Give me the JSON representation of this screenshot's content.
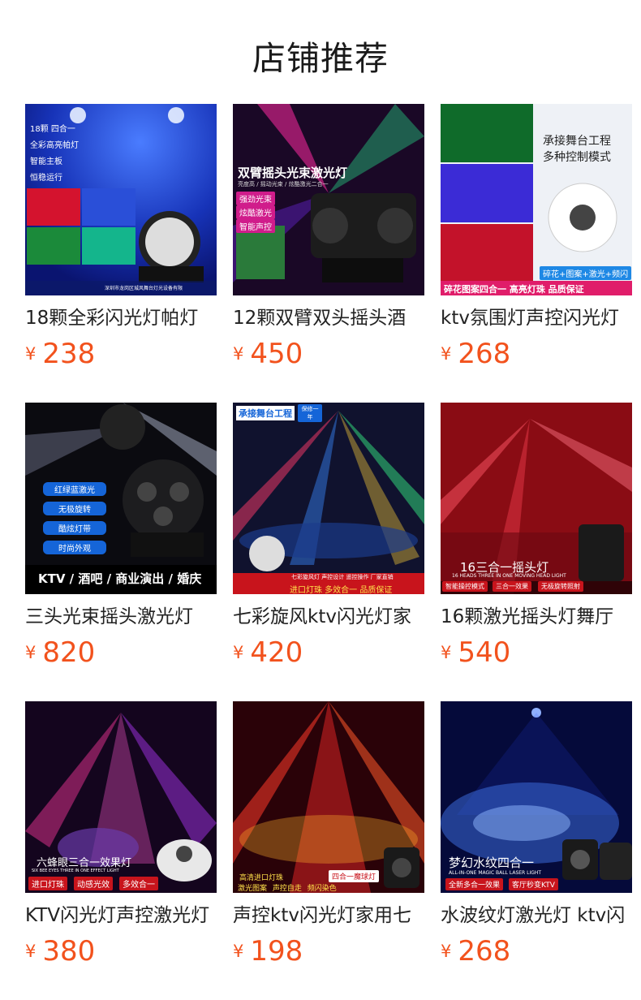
{
  "section_title": "店铺推荐",
  "currency": "¥",
  "colors": {
    "price": "#f2521d",
    "title": "#1a1a1a"
  },
  "products": [
    {
      "name": "18颗全彩闪光灯帕灯",
      "price": "238",
      "overlay": {
        "lines": [
          "18颗  四合一",
          "全彩高亮帕灯",
          "智能主板",
          "恒稳运行"
        ],
        "footer": "深圳市龙岗区城风舞台灯光设备有限"
      }
    },
    {
      "name": "12颗双臂双头摇头酒",
      "price": "450",
      "overlay": {
        "headline": "双臂摇头光束激光灯",
        "sub": "亮度高 / 摇动光束 / 炫酷激光二合一",
        "badges": [
          "强劲光束",
          "炫酷激光",
          "智能声控"
        ]
      }
    },
    {
      "name": "ktv氛围灯声控闪光灯",
      "price": "268",
      "overlay": {
        "right": [
          "承接舞台工程",
          "多种控制模式"
        ],
        "pill": "碎花+图案+激光+频闪",
        "bottom": "碎花图案四合一  高亮灯珠  品质保证"
      }
    },
    {
      "name": "三头光束摇头激光灯",
      "price": "820",
      "overlay": {
        "pills": [
          "红绿蓝激光",
          "无极旋转",
          "酷炫灯带",
          "时尚外观"
        ],
        "bottom": "KTV / 酒吧 / 商业演出 / 婚庆"
      }
    },
    {
      "name": "七彩旋风ktv闪光灯家",
      "price": "420",
      "overlay": {
        "top": "承接舞台工程",
        "badge": "保修一年",
        "strip": "七彩旋风灯  声控设计  遥控操作  厂家直销",
        "bottom": "进口灯珠  多效合一  品质保证"
      }
    },
    {
      "name": "16颗激光摇头灯舞厅",
      "price": "540",
      "overlay": {
        "headline": "16三合一摇头灯",
        "sub": "16 HEADS THREE IN ONE MOVING HEAD LIGHT",
        "tags": [
          "智能操控模式",
          "三合一效果",
          "无极旋转照射"
        ]
      }
    },
    {
      "name": "KTV闪光灯声控激光灯",
      "price": "380",
      "overlay": {
        "headline": "六蜂眼三合一效果灯",
        "sub": "SIX BEE EYES THREE IN ONE EFFECT LIGHT",
        "tags": [
          "进口灯珠",
          "动感光效",
          "多效合一"
        ]
      }
    },
    {
      "name": "声控ktv闪光灯家用七",
      "price": "198",
      "overlay": {
        "left": "高清进口灯珠",
        "right": "四合一魔球灯",
        "tags": [
          "激光图案",
          "声控自走",
          "频闪染色"
        ]
      }
    },
    {
      "name": "水波纹灯激光灯 ktv闪",
      "price": "268",
      "overlay": {
        "headline": "梦幻水纹四合一",
        "sub": "ALL-IN-ONE MAGIC BALL LASER LIGHT",
        "tags": [
          "全新多合一效果",
          "客厅秒变KTV"
        ]
      }
    }
  ]
}
